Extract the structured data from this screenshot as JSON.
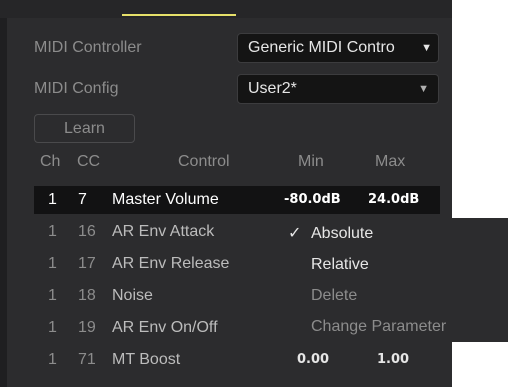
{
  "settings": {
    "midi_controller_label": "MIDI Controller",
    "midi_controller_value": "Generic MIDI Contro",
    "midi_config_label": "MIDI Config",
    "midi_config_value": "User2*",
    "learn_label": "Learn"
  },
  "table": {
    "headers": {
      "ch": "Ch",
      "cc": "CC",
      "control": "Control",
      "min": "Min",
      "max": "Max"
    },
    "rows": [
      {
        "ch": "1",
        "cc": "7",
        "control": "Master Volume",
        "min": "-80.0dB",
        "max": "24.0dB",
        "selected": true
      },
      {
        "ch": "1",
        "cc": "16",
        "control": "AR Env Attack",
        "min": "",
        "max": ""
      },
      {
        "ch": "1",
        "cc": "17",
        "control": "AR Env Release",
        "min": "",
        "max": ""
      },
      {
        "ch": "1",
        "cc": "18",
        "control": "Noise",
        "min": "",
        "max": ""
      },
      {
        "ch": "1",
        "cc": "19",
        "control": "AR Env On/Off",
        "min": "",
        "max": ""
      },
      {
        "ch": "1",
        "cc": "71",
        "control": "MT Boost",
        "min": "0.00",
        "max": "1.00"
      }
    ]
  },
  "context_menu": {
    "items": [
      {
        "label": "Absolute",
        "checked": true,
        "check_mark": "✓"
      },
      {
        "label": "Relative",
        "checked": false
      },
      {
        "label": "Delete",
        "checked": false,
        "disabled": true
      },
      {
        "label": "Change Parameter",
        "checked": false,
        "disabled": true
      }
    ]
  },
  "colors": {
    "panel_background": "#2c2c2e",
    "selected_row": "#121213",
    "accent_tab_indicator": "#e6e06a",
    "dropdown_background": "#141414"
  },
  "icons": {
    "dropdown_caret": "▼",
    "check": "✓"
  }
}
